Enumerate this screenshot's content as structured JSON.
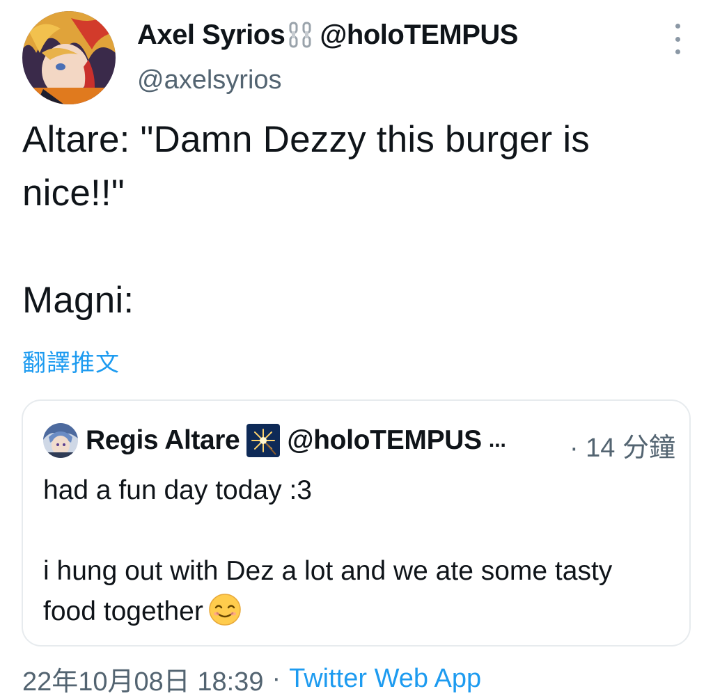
{
  "tweet": {
    "author": {
      "display_name": "Axel Syrios",
      "affiliation": "@holoTEMPUS",
      "handle": "@axelsyrios",
      "avatar_icon": "axel-avatar",
      "name_icon": "chain-icon"
    },
    "text": "Altare: \"Damn Dezzy this burger is nice!!\"\n\nMagni:",
    "translate_label": "翻譯推文",
    "more_icon": "more-vertical-icon",
    "timestamp": "22年10月08日 18:39",
    "separator": "·",
    "source": "Twitter Web App"
  },
  "quoted_tweet": {
    "author": {
      "display_name": "Regis Altare",
      "affiliation": "@holoTEMPUS",
      "ellipsis": "...",
      "avatar_icon": "regis-avatar",
      "name_icon": "sparkler-icon"
    },
    "time": "· 14 分鐘",
    "text": "had a fun day today :3\n\ni hung out with Dez a lot and we ate some tasty food together",
    "emoji": "smiling-face-icon"
  },
  "colors": {
    "text": "#0f1419",
    "secondary": "#536471",
    "link": "#1d9bf0",
    "border": "#e7ebee"
  }
}
